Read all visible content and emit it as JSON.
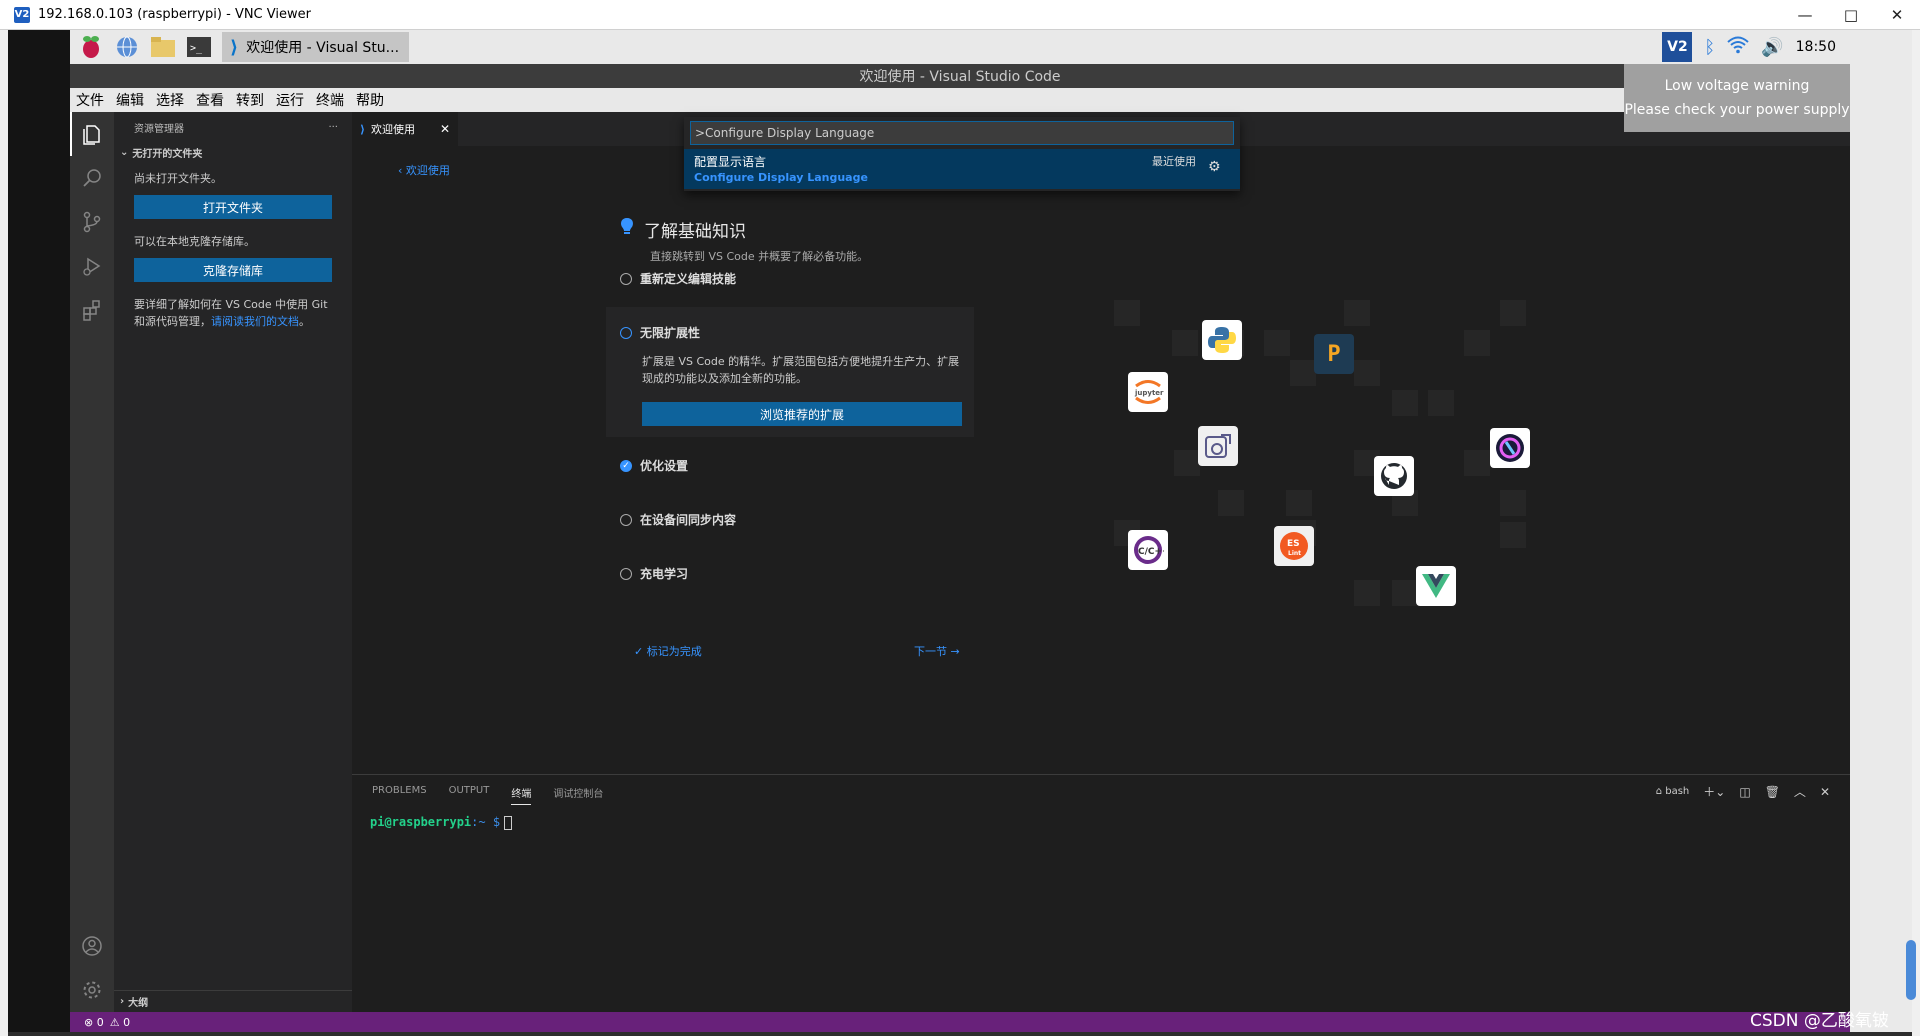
{
  "vnc": {
    "logo": "V2",
    "title": "192.168.0.103 (raspberrypi) - VNC Viewer",
    "minimize": "—",
    "maximize": "□",
    "close": "✕"
  },
  "taskbar": {
    "active_task": "欢迎使用 - Visual Stu...",
    "tray_vnc": "V2",
    "time": "18:50"
  },
  "vscode": {
    "window_title": "欢迎使用 - Visual Studio Code",
    "menu": [
      "文件",
      "编辑",
      "选择",
      "查看",
      "转到",
      "运行",
      "终端",
      "帮助"
    ],
    "sidebar": {
      "title": "资源管理器",
      "more": "···",
      "section": "无打开的文件夹",
      "no_folder": "尚未打开文件夹。",
      "open_folder_btn": "打开文件夹",
      "clone_text": "可以在本地克隆存储库。",
      "clone_btn": "克隆存储库",
      "git_text": "要详细了解如何在 VS Code 中使用 Git 和源代码管理，",
      "git_link": "请阅读我们的文档",
      "git_end": "。",
      "outline": "大纲"
    },
    "tab": {
      "label": "欢迎使用",
      "close": "✕"
    },
    "walkthrough": {
      "back": "欢迎使用",
      "title": "了解基础知识",
      "subtitle": "直接跳转到 VS Code 并概要了解必备功能。",
      "steps": [
        {
          "label": "重新定义编辑技能",
          "state": "todo"
        },
        {
          "label": "无限扩展性",
          "state": "active"
        },
        {
          "label": "优化设置",
          "state": "done"
        },
        {
          "label": "在设备间同步内容",
          "state": "todo"
        },
        {
          "label": "充电学习",
          "state": "todo"
        }
      ],
      "expanded_desc": "扩展是 VS Code 的精华。扩展范围包括方便地提升生产力、扩展现成的功能以及添加全新的功能。",
      "expanded_btn": "浏览推荐的扩展",
      "mark_done": "标记为完成",
      "next": "下一节 →"
    },
    "palette": {
      "input_value": ">Configure Display Language",
      "item_label": "配置显示语言",
      "item_detail": "Configure Display Language",
      "item_badge": "最近使用"
    },
    "panel": {
      "tabs": [
        "PROBLEMS",
        "OUTPUT",
        "终端",
        "调试控制台"
      ],
      "active_tab": 2,
      "shell": "bash",
      "prompt_user": "pi@raspberrypi",
      "prompt_path": ":~ ",
      "prompt_dollar": "$"
    },
    "statusbar": {
      "errors": "⊗ 0",
      "warnings": "⚠ 0"
    }
  },
  "notification": {
    "line1": "Low voltage warning",
    "line2": "Please check your power supply"
  },
  "watermark": "CSDN @乙酸氧铍",
  "colors": {
    "accent": "#0e639c",
    "link": "#3794ff",
    "statusbar": "#68217a",
    "editor_bg": "#1e1e1e",
    "sidebar_bg": "#252526"
  },
  "extension_icons": [
    "python-icon",
    "jupyter-icon",
    "remote-icon",
    "github-icon",
    "cpp-icon",
    "eslint-icon",
    "vue-icon",
    "codetour-icon",
    "gitlens-icon"
  ]
}
